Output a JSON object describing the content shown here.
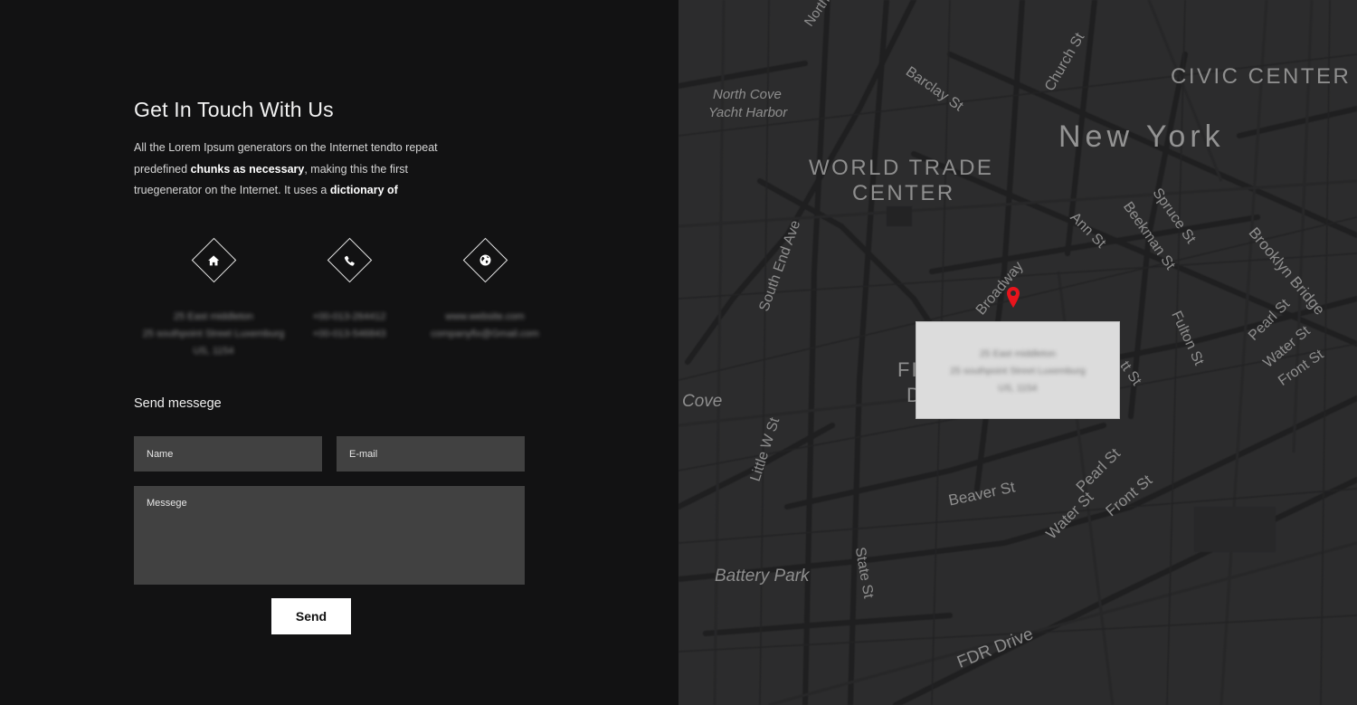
{
  "contact": {
    "title": "Get In Touch With Us",
    "intro": {
      "p1": "All the Lorem Ipsum generators on the Internet tendto repeat predefined ",
      "b1": "chunks as necessary",
      "p2": ", making this the first truegenerator on the Internet. It uses a ",
      "b2": "dictionary of"
    },
    "items": [
      {
        "icon": "home-icon",
        "lines": [
          "25 East middleton",
          "25 southpoint Street Luxemburg",
          "US, 1154"
        ]
      },
      {
        "icon": "phone-icon",
        "lines": [
          "+00-013-264412",
          "+00-013-546843"
        ]
      },
      {
        "icon": "globe-icon",
        "lines": [
          "www.website.com",
          "companyfix@Gmail.com"
        ]
      }
    ]
  },
  "form": {
    "title": "Send messege",
    "name_placeholder": "Name",
    "email_placeholder": "E-mail",
    "message_placeholder": "Messege",
    "send_label": "Send"
  },
  "map": {
    "labels": {
      "north_cove": "North Cove",
      "yacht_harbor": "Yacht Harbor",
      "barclay": "Barclay St",
      "church": "Church St",
      "civic_center": "CIVIC CENTER",
      "new_york": "New York",
      "wtc1": "WORLD TRADE",
      "wtc2": "CENTER",
      "south_end": "South End Ave",
      "ann": "Ann St",
      "beekman": "Beekman St",
      "spruce": "Spruce St",
      "brooklyn_bridge": "Brooklyn Bridge",
      "broadway": "Broadway",
      "fulton": "Fulton St",
      "pearl_ne": "Pearl St",
      "water_ne": "Water St",
      "front_ne": "Front St",
      "cove": "Cove",
      "little_w": "Little W St",
      "beaver": "Beaver St",
      "pearl": "Pearl St",
      "water": "Water St",
      "front": "Front St",
      "state": "State St",
      "battery": "Battery Park",
      "fdr": "FDR Drive",
      "fi": "FI",
      "di": "DI",
      "north": "North",
      "tt": "tt St"
    },
    "info_lines": [
      "25 East middleton",
      "25 southpoint Street Luxemburg",
      "US, 1154"
    ],
    "pin_color": "#e8141c"
  }
}
